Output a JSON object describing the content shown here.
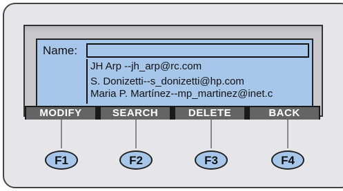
{
  "screen": {
    "name_label": "Name:",
    "name_value": "",
    "results": [
      "JH Arp  --jh_arp@rc.com",
      "S. Donizetti--s_donizetti@hp.com",
      "Maria P. Martínez--mp_martinez@inet.c"
    ]
  },
  "softkeys": [
    "MODIFY",
    "SEARCH",
    "DELETE",
    "BACK"
  ],
  "function_keys": [
    "F1",
    "F2",
    "F3",
    "F4"
  ],
  "colors": {
    "lcd_background": "#a7c7ea",
    "softkey_background": "#646464",
    "device_background": "#e6e6e8"
  }
}
